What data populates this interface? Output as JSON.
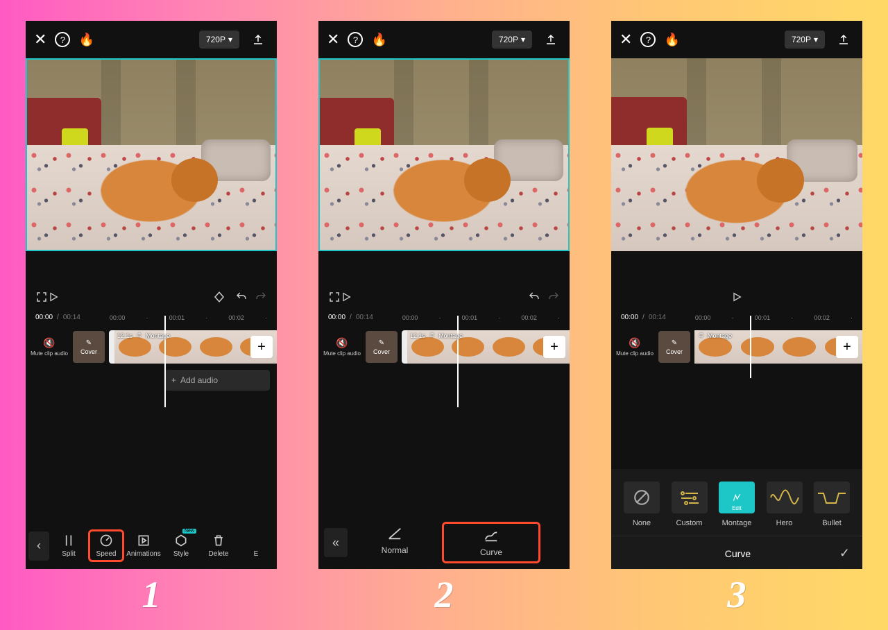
{
  "steps": [
    "1",
    "2",
    "3"
  ],
  "topbar": {
    "resolution": "720P"
  },
  "timebar": {
    "current": "00:00",
    "duration": "00:14",
    "ticks": [
      "00:00",
      "00:01",
      "00:02"
    ]
  },
  "timeline": {
    "mute_label": "Mute clip audio",
    "cover_label": "Cover",
    "clip_duration": "12.1s",
    "clip_effect": "Montage",
    "add_audio": "Add audio"
  },
  "tools1": {
    "split": "Split",
    "speed": "Speed",
    "animations": "Animations",
    "style": "Style",
    "style_tag": "New",
    "delete": "Delete",
    "extra": "E"
  },
  "tools2": {
    "normal": "Normal",
    "curve": "Curve"
  },
  "curve": {
    "none": "None",
    "custom": "Custom",
    "montage": "Montage",
    "montage_edit": "Edit",
    "hero": "Hero",
    "bullet": "Bullet",
    "title": "Curve"
  }
}
